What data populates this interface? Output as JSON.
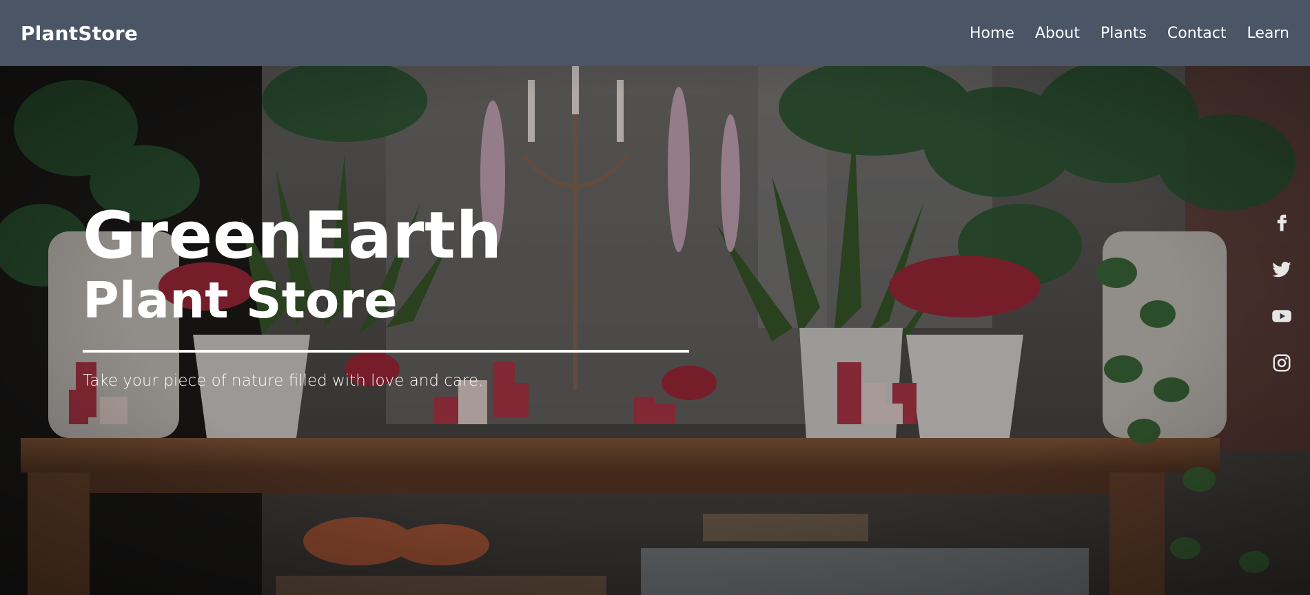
{
  "brand": "PlantStore",
  "nav": {
    "home": "Home",
    "about": "About",
    "plants": "Plants",
    "contact": "Contact",
    "learn": "Learn"
  },
  "hero": {
    "title_line1": "GreenEarth",
    "title_line2": "Plant Store",
    "tagline": "Take your piece of nature filled with love and care."
  },
  "social_icons": [
    "facebook-icon",
    "twitter-icon",
    "youtube-icon",
    "instagram-icon"
  ],
  "colors": {
    "navbar": "#4a5566",
    "text": "#ffffff"
  }
}
